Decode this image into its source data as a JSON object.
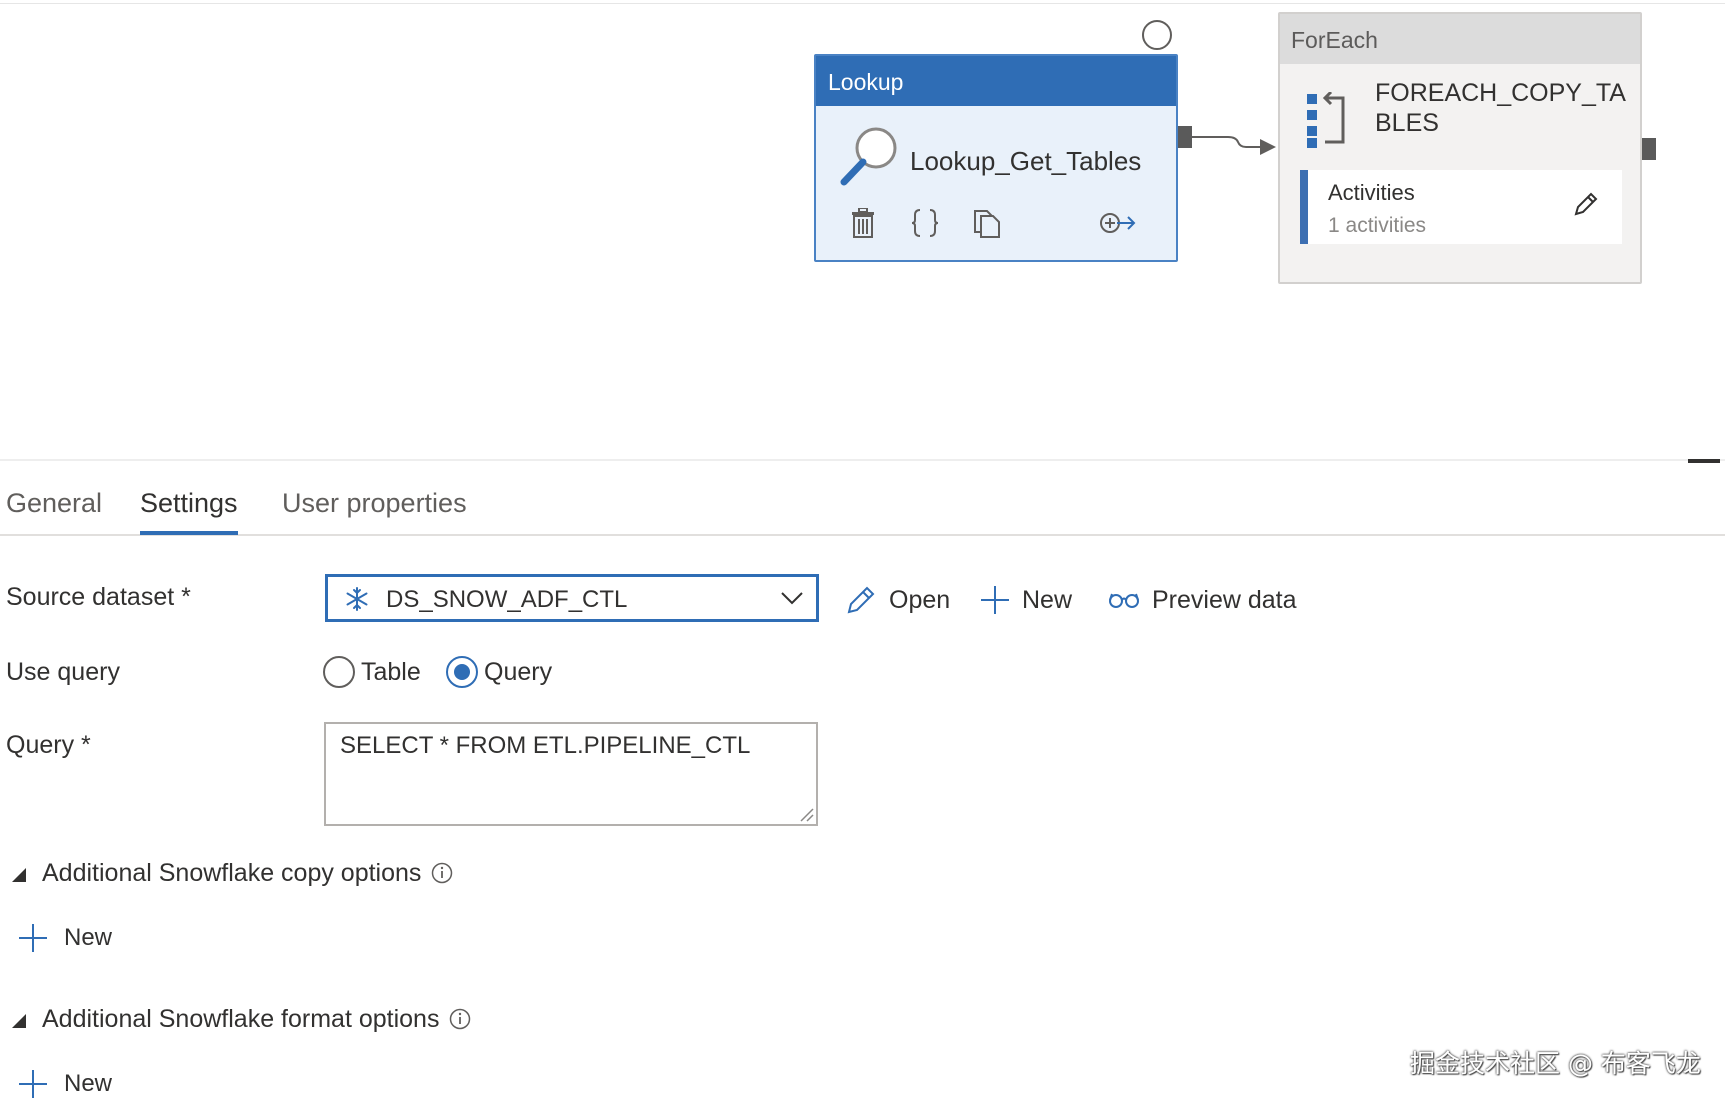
{
  "canvas": {
    "lookup": {
      "type_label": "Lookup",
      "name": "Lookup_Get_Tables"
    },
    "foreach": {
      "type_label": "ForEach",
      "name": "FOREACH_COPY_TABLES",
      "activities_label": "Activities",
      "activities_count": "1 activities"
    }
  },
  "tabs": [
    {
      "label": "General"
    },
    {
      "label": "Settings",
      "active": true
    },
    {
      "label": "User properties"
    }
  ],
  "form": {
    "source_dataset": {
      "label": "Source dataset",
      "required_mark": "*",
      "value": "DS_SNOW_ADF_CTL",
      "icon": "snowflake-icon"
    },
    "dataset_actions": {
      "open": "Open",
      "new": "New",
      "preview": "Preview data"
    },
    "use_query": {
      "label": "Use query",
      "options": [
        "Table",
        "Query"
      ],
      "selected": "Query"
    },
    "query": {
      "label": "Query",
      "required_mark": "*",
      "value": "SELECT * FROM ETL.PIPELINE_CTL"
    },
    "copy_options": {
      "title": "Additional Snowflake copy options",
      "new_label": "New"
    },
    "format_options": {
      "title": "Additional Snowflake format options",
      "new_label": "New"
    }
  },
  "watermark": "掘金技术社区 @ 布客飞龙",
  "colors": {
    "accent": "#2f6db5",
    "lookup_body": "#e9f1fa",
    "foreach_body": "#f3f2f1",
    "text": "#323130"
  }
}
